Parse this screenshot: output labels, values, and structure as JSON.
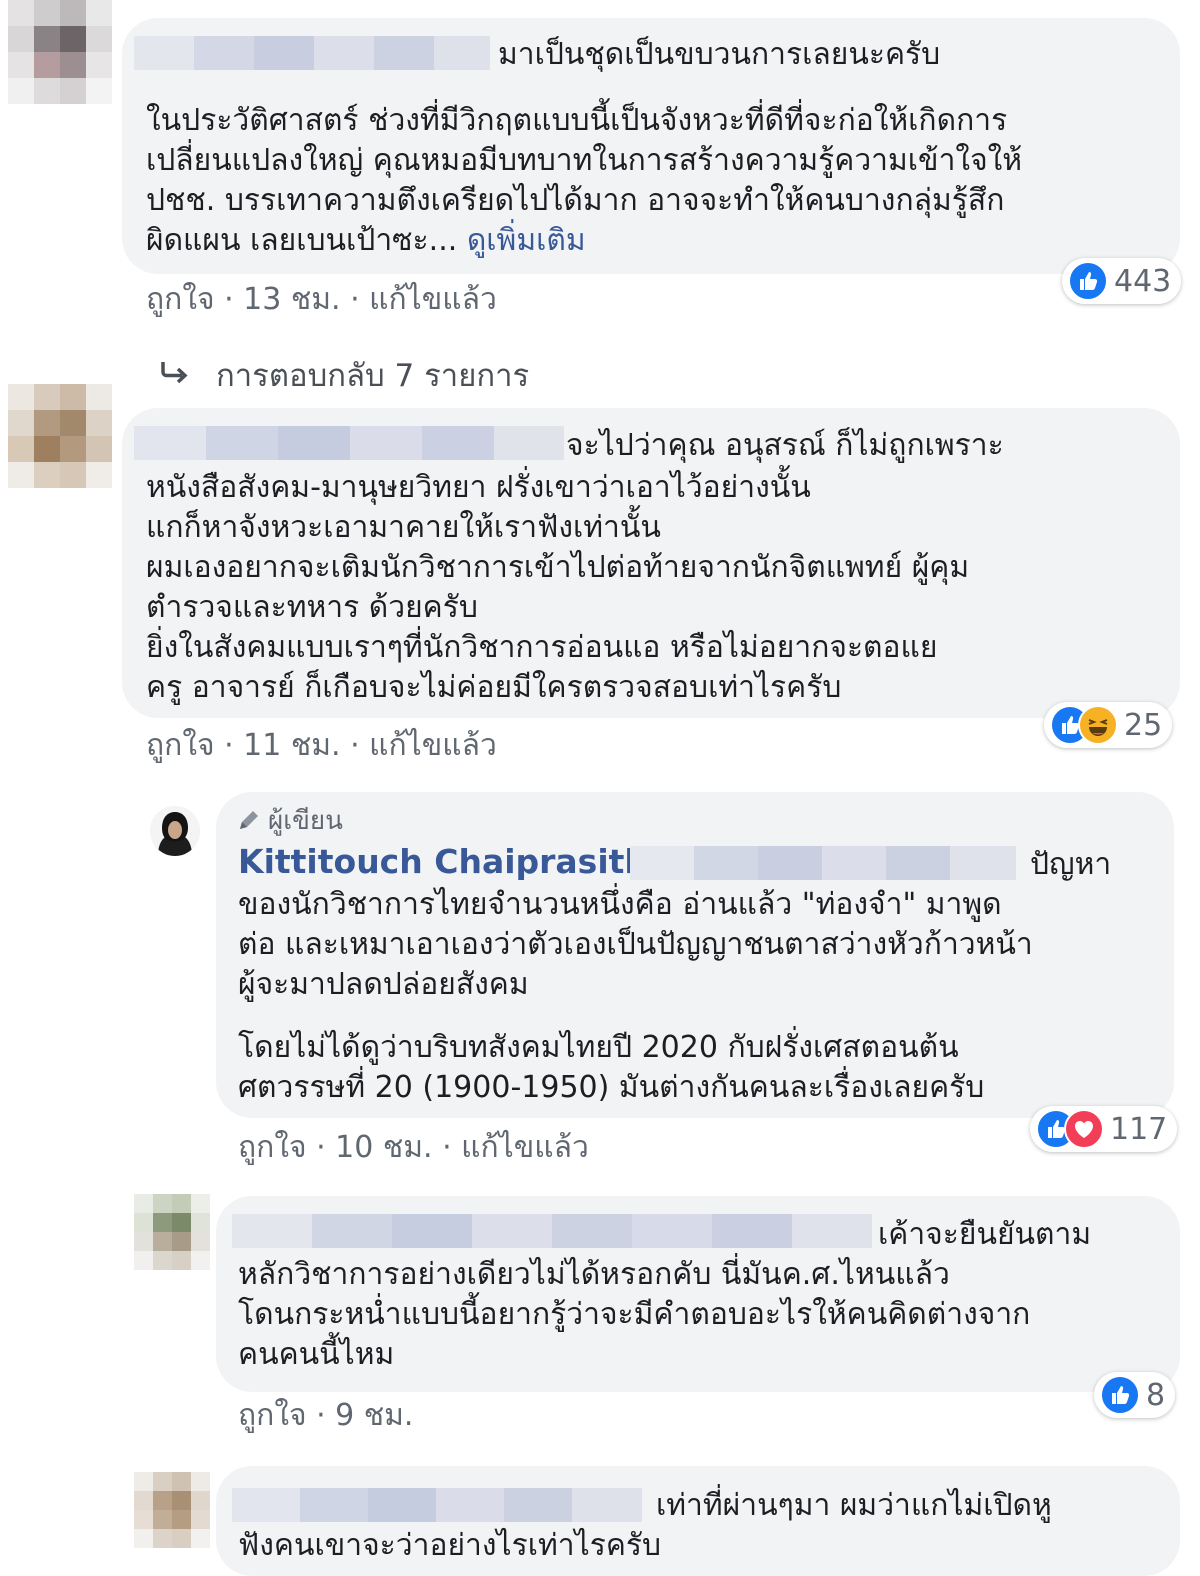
{
  "comments": [
    {
      "text_lines": [
        "มาเป็นชุดเป็นขบวนการเลยนะครับ",
        "",
        "ในประวัติศาสตร์ ช่วงที่มีวิกฤตแบบนี้เป็นจังหวะที่ดีที่จะก่อให้เกิดการ",
        "เปลี่ยนแปลงใหญ่ คุณหมอมีบทบาทในการสร้างความรู้ความเข้าใจให้",
        "ปชช. บรรเทาความตึงเครียดไปได้มาก อาจจะทำให้คนบางกลุ่มรู้สึก",
        "ผิดแผน เลยเบนเป้าซะ..."
      ],
      "see_more": "ดูเพิ่มเติม",
      "like_label": "ถูกใจ",
      "time": "13 ชม.",
      "edited": "แก้ไขแล้ว",
      "reaction_count": "443",
      "reaction_icons": [
        "like-icon"
      ]
    },
    {
      "text_lines": [
        "จะไปว่าคุณ อนุสรณ์ ก็ไม่ถูกเพราะ",
        "หนังสือสังคม-มานุษยวิทยา ฝรั่งเขาว่าเอาไว้อย่างนั้น",
        "แกก็หาจังหวะเอามาคายให้เราฟังเท่านั้น",
        "ผมเองอยากจะเติมนักวิชาการเข้าไปต่อท้ายจากนักจิตแพทย์ ผู้คุม",
        "ตำรวจและทหาร ด้วยครับ",
        "ยิ่งในสังคมแบบเราๆที่นักวิชาการอ่อนแอ หรือไม่อยากจะตอแย",
        "ครู อาจารย์ ก็เกือบจะไม่ค่อยมีใครตรวจสอบเท่าไรครับ"
      ],
      "like_label": "ถูกใจ",
      "time": "11 ชม.",
      "edited": "แก้ไขแล้ว",
      "reaction_count": "25",
      "reaction_icons": [
        "like-icon",
        "haha-icon"
      ]
    }
  ],
  "replies_toggle": "การตอบกลับ 7 รายการ",
  "reply_author": {
    "badge": "ผู้เขียน",
    "name": "Kittitouch Chaiprasith",
    "text_lines": [
      "ปัญหา",
      "ของนักวิชาการไทยจำนวนหนึ่งคือ อ่านแล้ว \"ท่องจำ\" มาพูด",
      "ต่อ และเหมาเอาเองว่าตัวเองเป็นปัญญาชนตาสว่างหัวก้าวหน้า",
      "ผู้จะมาปลดปล่อยสังคม",
      "",
      "โดยไม่ได้ดูว่าบริบทสังคมไทยปี 2020 กับฝรั่งเศสตอนต้น",
      "ศตวรรษที่ 20 (1900-1950) มันต่างกันคนละเรื่องเลยครับ"
    ],
    "like_label": "ถูกใจ",
    "time": "10 ชม.",
    "edited": "แก้ไขแล้ว",
    "reaction_count": "117",
    "reaction_icons": [
      "like-icon",
      "love-icon"
    ]
  },
  "reply_2": {
    "text_lines": [
      "เค้าจะยืนยันตาม",
      "หลักวิชาการอย่างเดียวไม่ได้หรอกคับ นี่มันค.ศ.ไหนแล้ว",
      "โดนกระหน่ำแบบนี้อยากรู้ว่าจะมีคำตอบอะไรให้คนคิดต่างจาก",
      "คนคนนี้ไหม"
    ],
    "like_label": "ถูกใจ",
    "time": "9 ชม.",
    "reaction_count": "8",
    "reaction_icons": [
      "like-icon"
    ]
  },
  "reply_3": {
    "text_lines": [
      "เท่าที่ผ่านๆมา ผมว่าแกไม่เปิดหู",
      "ฟังคนเขาจะว่าอย่างไรเท่าไรครับ"
    ]
  },
  "colors": {
    "bubble": "#f2f3f5",
    "link": "#385898",
    "meta": "#606770",
    "like": "#1877f2",
    "love": "#f33e58",
    "haha": "#f7b125"
  }
}
